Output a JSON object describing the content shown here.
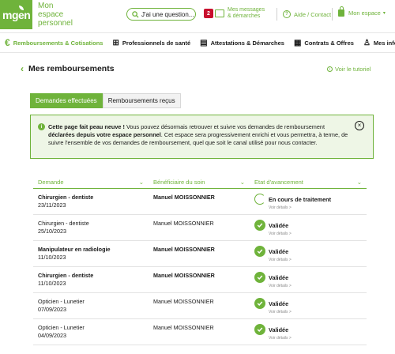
{
  "header": {
    "logo": "mgen",
    "brand_line1": "Mon",
    "brand_line2": "espace",
    "brand_line3": "personnel",
    "search_label": "J'ai une question...",
    "messages_count": "2",
    "messages_line1": "Mes messages",
    "messages_line2": "& démarches",
    "help_label": "Aide / Contact",
    "account_label": "Mon espace"
  },
  "nav": {
    "items": [
      {
        "label": "Remboursements & Cotisations",
        "icon": "euro-icon"
      },
      {
        "label": "Professionnels de santé",
        "icon": "medical-case-icon"
      },
      {
        "label": "Attestations & Démarches",
        "icon": "document-icon"
      },
      {
        "label": "Contrats & Offres",
        "icon": "contract-icon"
      },
      {
        "label": "Mes infos",
        "icon": "user-icon"
      }
    ]
  },
  "page": {
    "title": "Mes remboursements",
    "tutorial": "Voir le tutoriel"
  },
  "tabs": {
    "tab1": "Demandes effectuées",
    "tab2": "Remboursements reçus"
  },
  "info": {
    "bold1": "Cette page fait peau neuve !",
    "text1": " Vous pouvez désormais retrouver et suivre vos demandes de remboursement ",
    "bold2": "déclarées depuis votre espace personnel",
    "text2": ". Cet espace sera progressivement enrichi et vous permettra, à terme, de suivre l'ensemble de vos demandes de remboursement, quel que soit le canal utilisé pour nous contacter."
  },
  "table": {
    "col1": "Demande",
    "col2": "Bénéficiaire du soin",
    "col3": "Etat d'avancement",
    "details_label": "Voir détails >",
    "rows": [
      {
        "demande": "Chirurgien - dentiste",
        "date": "23/11/2023",
        "beneficiaire": "Manuel MOISSONNIER",
        "etat": "En cours de traitement"
      },
      {
        "demande": "Chirurgien - dentiste",
        "date": "25/10/2023",
        "beneficiaire": "Manuel MOISSONNIER",
        "etat": "Validée"
      },
      {
        "demande": "Manipulateur en radiologie",
        "date": "11/10/2023",
        "beneficiaire": "Manuel MOISSONNIER",
        "etat": "Validée"
      },
      {
        "demande": "Chirurgien - dentiste",
        "date": "11/10/2023",
        "beneficiaire": "Manuel MOISSONNIER",
        "etat": "Validée"
      },
      {
        "demande": "Opticien - Lunetier",
        "date": "07/09/2023",
        "beneficiaire": "Manuel MOISSONNIER",
        "etat": "Validée"
      },
      {
        "demande": "Opticien - Lunetier",
        "date": "04/09/2023",
        "beneficiaire": "Manuel MOISSONNIER",
        "etat": "Validée"
      }
    ]
  },
  "colors": {
    "brand": "#6fb33b",
    "badge": "#c8102e"
  }
}
